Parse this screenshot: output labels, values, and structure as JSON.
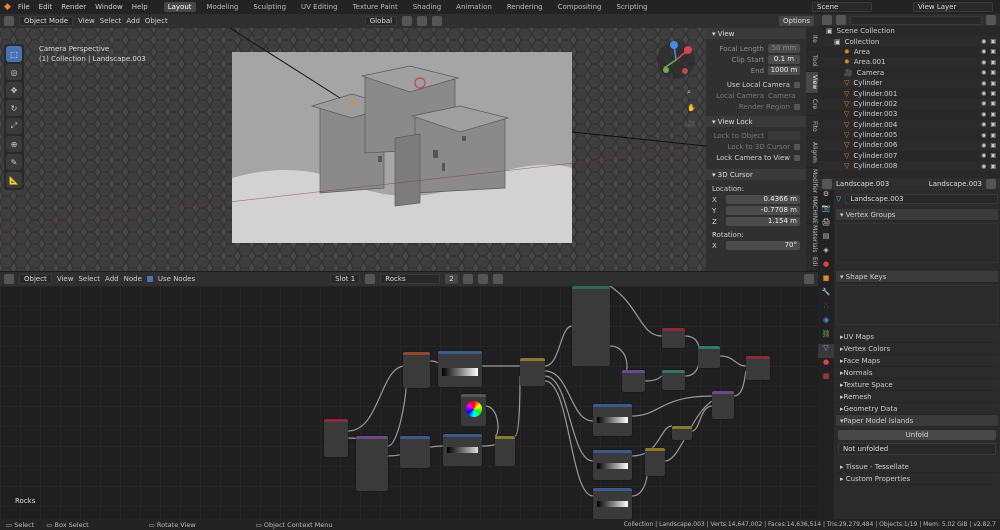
{
  "topbar": {
    "menus": [
      "File",
      "Edit",
      "Render",
      "Window",
      "Help"
    ],
    "workspaces": [
      "Layout",
      "Modeling",
      "Sculpting",
      "UV Editing",
      "Texture Paint",
      "Shading",
      "Animation",
      "Rendering",
      "Compositing",
      "Scripting"
    ],
    "active_workspace": "Layout",
    "scene": "Scene",
    "view_layer": "View Layer"
  },
  "viewport_header": {
    "mode": "Object Mode",
    "menus": [
      "View",
      "Select",
      "Add",
      "Object"
    ],
    "transform_orientation": "Global",
    "options": "Options"
  },
  "viewport": {
    "camera_label": "Camera Perspective",
    "context_label": "(1) Collection | Landscape.003"
  },
  "sidebar_tabs": [
    "Ite",
    "Tool",
    "View",
    "Cre",
    "Fito",
    "Alignm",
    "Modifier",
    "MACHINE",
    "Materials",
    "Edi"
  ],
  "view_panel": {
    "header": "View",
    "focal_length_label": "Focal Length",
    "focal_length": "50 mm",
    "clip_start_label": "Clip Start",
    "clip_start": "0.1 m",
    "end_label": "End",
    "end": "1000 m",
    "use_local_camera": "Use Local Camera",
    "local_camera_label": "Local Camera",
    "local_camera": "Camera",
    "render_region": "Render Region",
    "view_lock_header": "View Lock",
    "lock_to_object": "Lock to Object",
    "lock_to_3d_cursor": "Lock to 3D Cursor",
    "lock_camera_to_view": "Lock Camera to View",
    "cursor_header": "3D Cursor",
    "location_label": "Location:",
    "x_label": "X",
    "x": "0.4366 m",
    "y_label": "Y",
    "y": "-0.7708 m",
    "z_label": "Z",
    "z": "1.154 m",
    "rotation_label": "Rotation:",
    "rx": "70°"
  },
  "outliner": {
    "search_placeholder": "",
    "items": [
      "Scene Collection",
      "Collection",
      "Area",
      "Area.001",
      "Camera",
      "Cylinder",
      "Cylinder.001",
      "Cylinder.002",
      "Cylinder.003",
      "Cylinder.004",
      "Cylinder.005",
      "Cylinder.006",
      "Cylinder.007",
      "Cylinder.008"
    ]
  },
  "properties": {
    "object_name": "Landscape.003",
    "mesh_name": "Landscape.003",
    "data_name": "Landscape.003",
    "vertex_groups": "Vertex Groups",
    "shape_keys": "Shape Keys",
    "collapsed": [
      "UV Maps",
      "Vertex Colors",
      "Face Maps",
      "Normals",
      "Texture Space",
      "Remesh",
      "Geometry Data",
      "Paper Model Islands"
    ],
    "unfold_button": "Unfold",
    "not_unfolded": "Not unfolded",
    "tissue": "Tissue - Tessellate",
    "custom_props": "Custom Properties"
  },
  "node_header": {
    "type": "Object",
    "menus": [
      "View",
      "Select",
      "Add",
      "Node"
    ],
    "use_nodes": "Use Nodes",
    "slot": "Slot 1",
    "material": "Rocks",
    "users": "2"
  },
  "node_editor": {
    "material_label": "Rocks"
  },
  "statusbar": {
    "select": "Select",
    "box_select": "Box Select",
    "rotate_view": "Rotate View",
    "context_menu": "Object Context Menu",
    "stats": "Collection | Landscape.003 | Verts:14,647,002 | Faces:14,636,514 | Tris:29,279,484 | Objects:1/19 | Mem: 5.02 GiB | v2.82.7"
  },
  "colors": {
    "accent": "#4772b3",
    "node_purple": "#6b4a8a",
    "node_red": "#8a2b3a",
    "node_teal": "#2b7a6a",
    "node_yellow": "#8a7a2b",
    "node_blue": "#3a5a8a",
    "orange_object": "#e38a2c",
    "mesh_cyan": "#5ec8c8"
  }
}
